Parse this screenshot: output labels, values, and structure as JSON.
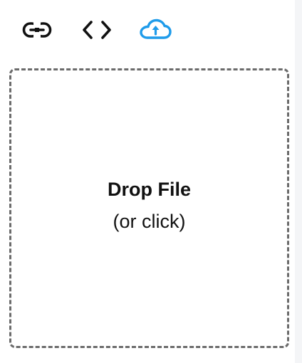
{
  "toolbar": {
    "items": [
      {
        "id": "link",
        "icon": "link-icon",
        "active": false
      },
      {
        "id": "embed",
        "icon": "code-icon",
        "active": false
      },
      {
        "id": "upload",
        "icon": "cloud-upload-icon",
        "active": true
      }
    ],
    "active_color": "#1e9bea",
    "inactive_color": "#111111"
  },
  "dropzone": {
    "title": "Drop File",
    "subtitle": "(or click)",
    "border_color": "#6b6b6b"
  }
}
